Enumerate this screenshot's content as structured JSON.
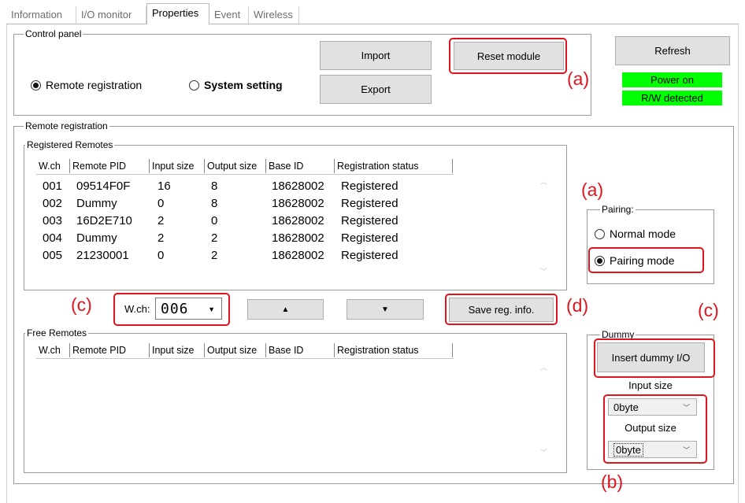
{
  "tabs": [
    {
      "label": "Information"
    },
    {
      "label": "I/O monitor"
    },
    {
      "label": "Properties"
    },
    {
      "label": "Event"
    },
    {
      "label": "Wireless"
    }
  ],
  "control_panel": {
    "title": "Control panel",
    "radio_remote": "Remote registration",
    "radio_system": "System setting",
    "import_label": "Import",
    "export_label": "Export",
    "reset_label": "Reset module",
    "refresh_label": "Refresh",
    "status_power": "Power on",
    "status_rw": "R/W detected",
    "status_color": "#00ff00"
  },
  "remote_registration": {
    "title": "Remote registration",
    "registered_title": "Registered Remotes",
    "free_title": "Free Remotes",
    "columns": [
      "W.ch",
      "Remote PID",
      "Input size",
      "Output size",
      "Base ID",
      "Registration status"
    ],
    "rows": [
      [
        "001",
        "09514F0F",
        "16",
        "8",
        "18628002",
        "Registered"
      ],
      [
        "002",
        "Dummy",
        "0",
        "8",
        "18628002",
        "Registered"
      ],
      [
        "003",
        "16D2E710",
        "2",
        "0",
        "18628002",
        "Registered"
      ],
      [
        "004",
        "Dummy",
        "2",
        "2",
        "18628002",
        "Registered"
      ],
      [
        "005",
        "21230001",
        "0",
        "2",
        "18628002",
        "Registered"
      ]
    ],
    "wch_label": "W.ch:",
    "wch_value": "006",
    "up_icon": "▲",
    "down_icon": "▼",
    "save_label": "Save reg. info."
  },
  "pairing": {
    "title": "Pairing:",
    "normal_label": "Normal mode",
    "pairing_label": "Pairing mode",
    "selected": "Pairing mode"
  },
  "dummy": {
    "title": "Dummy",
    "insert_label": "Insert dummy I/O",
    "input_size_label": "Input size",
    "input_size_value": "0byte",
    "output_size_label": "Output size",
    "output_size_value": "0byte"
  },
  "annotations": {
    "a": "(a)",
    "b": "(b)",
    "c": "(c)",
    "d": "(d)",
    "color": "#e0141e"
  }
}
